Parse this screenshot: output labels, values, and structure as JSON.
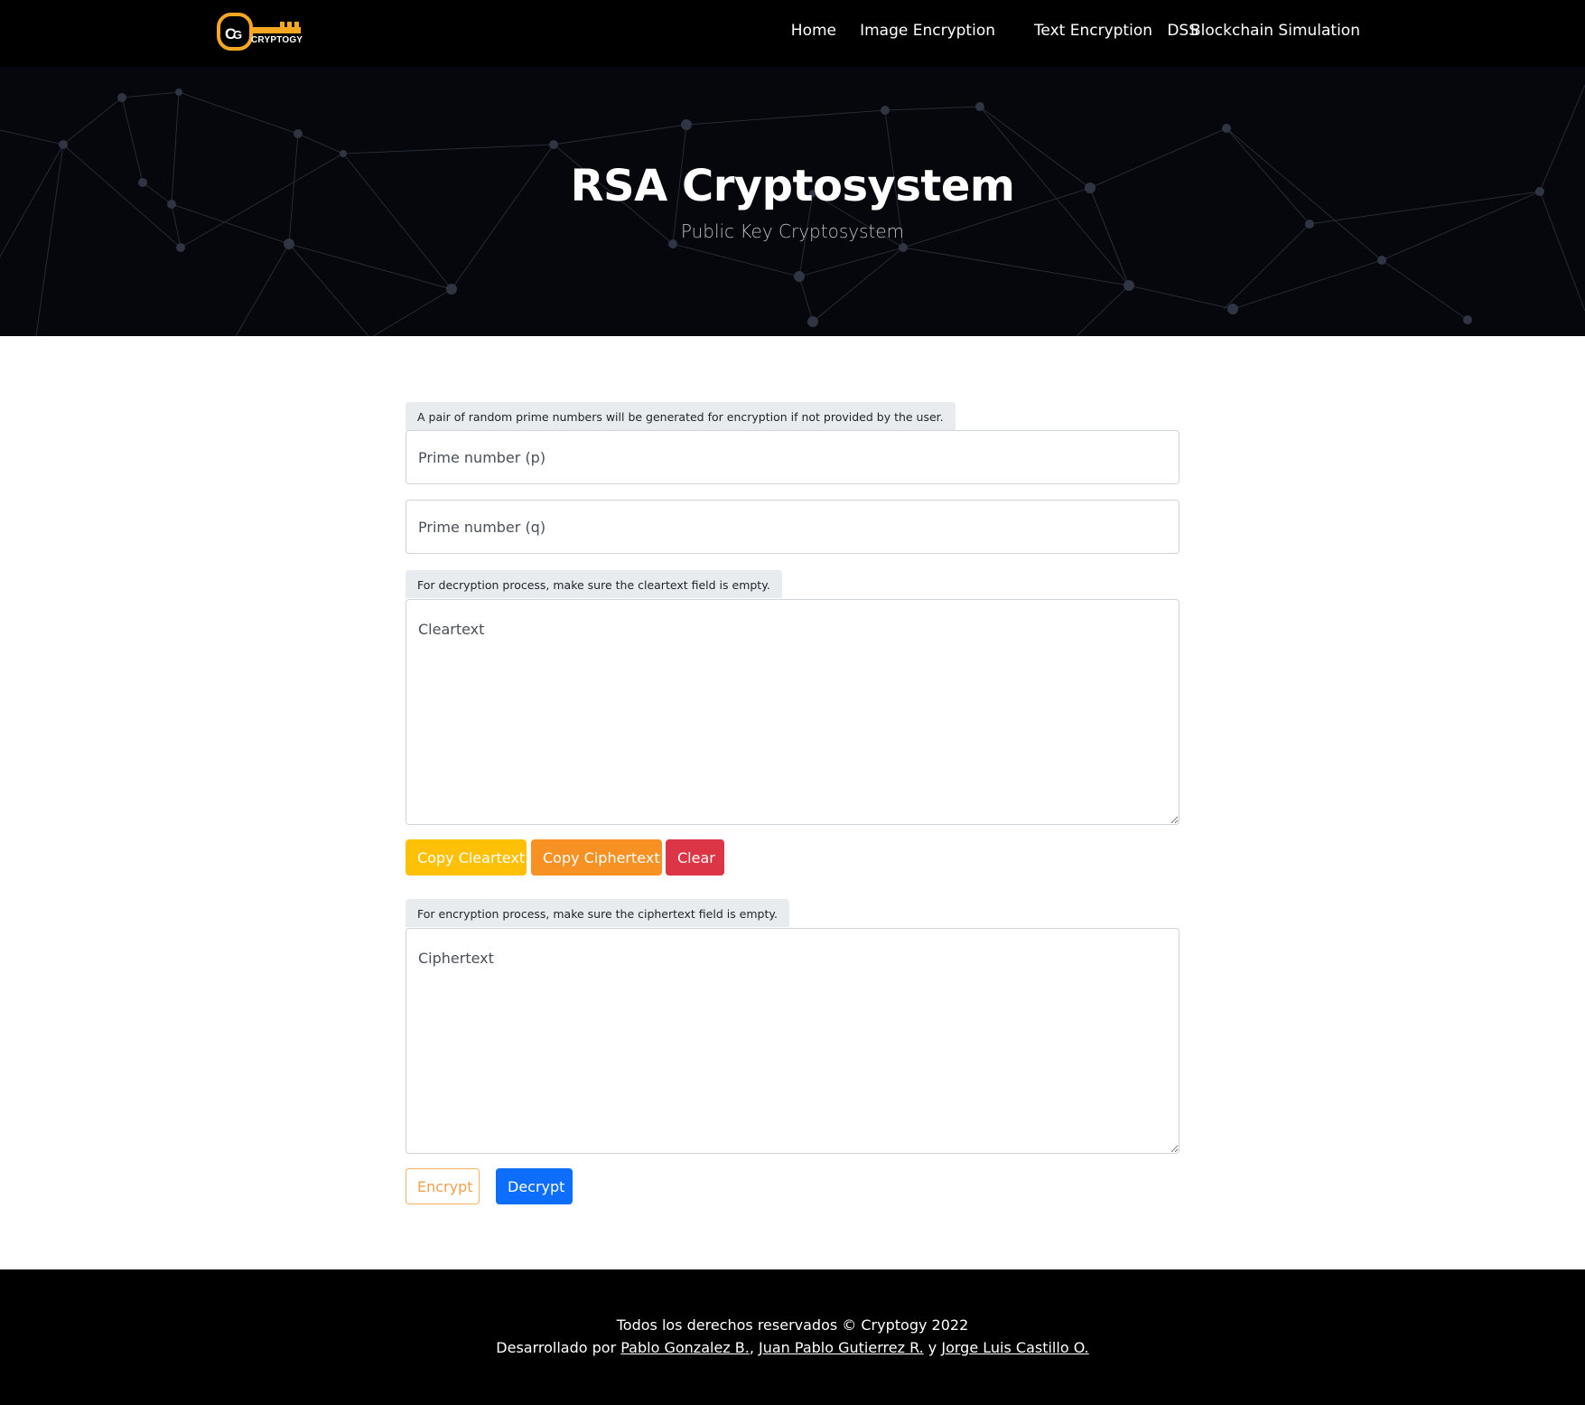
{
  "brand": {
    "name": "CRYPTOGY",
    "logo_icon": "key-icon"
  },
  "nav": {
    "items": [
      {
        "label": "Home"
      },
      {
        "label": "Image Encryption"
      },
      {
        "label": "Text Encryption"
      },
      {
        "label": "DSS"
      },
      {
        "label": "Blockchain Simulation"
      }
    ]
  },
  "hero": {
    "title": "RSA Cryptosystem",
    "subtitle": "Public Key Cryptosystem"
  },
  "form": {
    "prime_hint": "A pair of random prime numbers will be generated for encryption if not provided by the user.",
    "p_placeholder": "Prime number (p)",
    "q_placeholder": "Prime number (q)",
    "cleartext_hint": "For decryption process, make sure the cleartext field is empty.",
    "cleartext_placeholder": "Cleartext",
    "ciphertext_hint": "For encryption process, make sure the ciphertext field is empty.",
    "ciphertext_placeholder": "Ciphertext",
    "buttons": {
      "copy_cleartext": "Copy Cleartext",
      "copy_ciphertext": "Copy Ciphertext",
      "clear": "Clear",
      "encrypt": "Encrypt",
      "decrypt": "Decrypt"
    }
  },
  "footer": {
    "rights": "Todos los derechos reservados © Cryptogy 2022",
    "developed_by": "Desarrollado por",
    "sep1": ",",
    "sep2": "y",
    "authors": [
      "Pablo Gonzalez B.",
      "Juan Pablo Gutierrez R.",
      "Jorge Luis Castillo O."
    ]
  },
  "colors": {
    "accent_yellow": "#ffc107",
    "accent_orange": "#f79124",
    "danger": "#dc3545",
    "primary": "#0d6efd",
    "logo_gold": "#f7a823"
  }
}
